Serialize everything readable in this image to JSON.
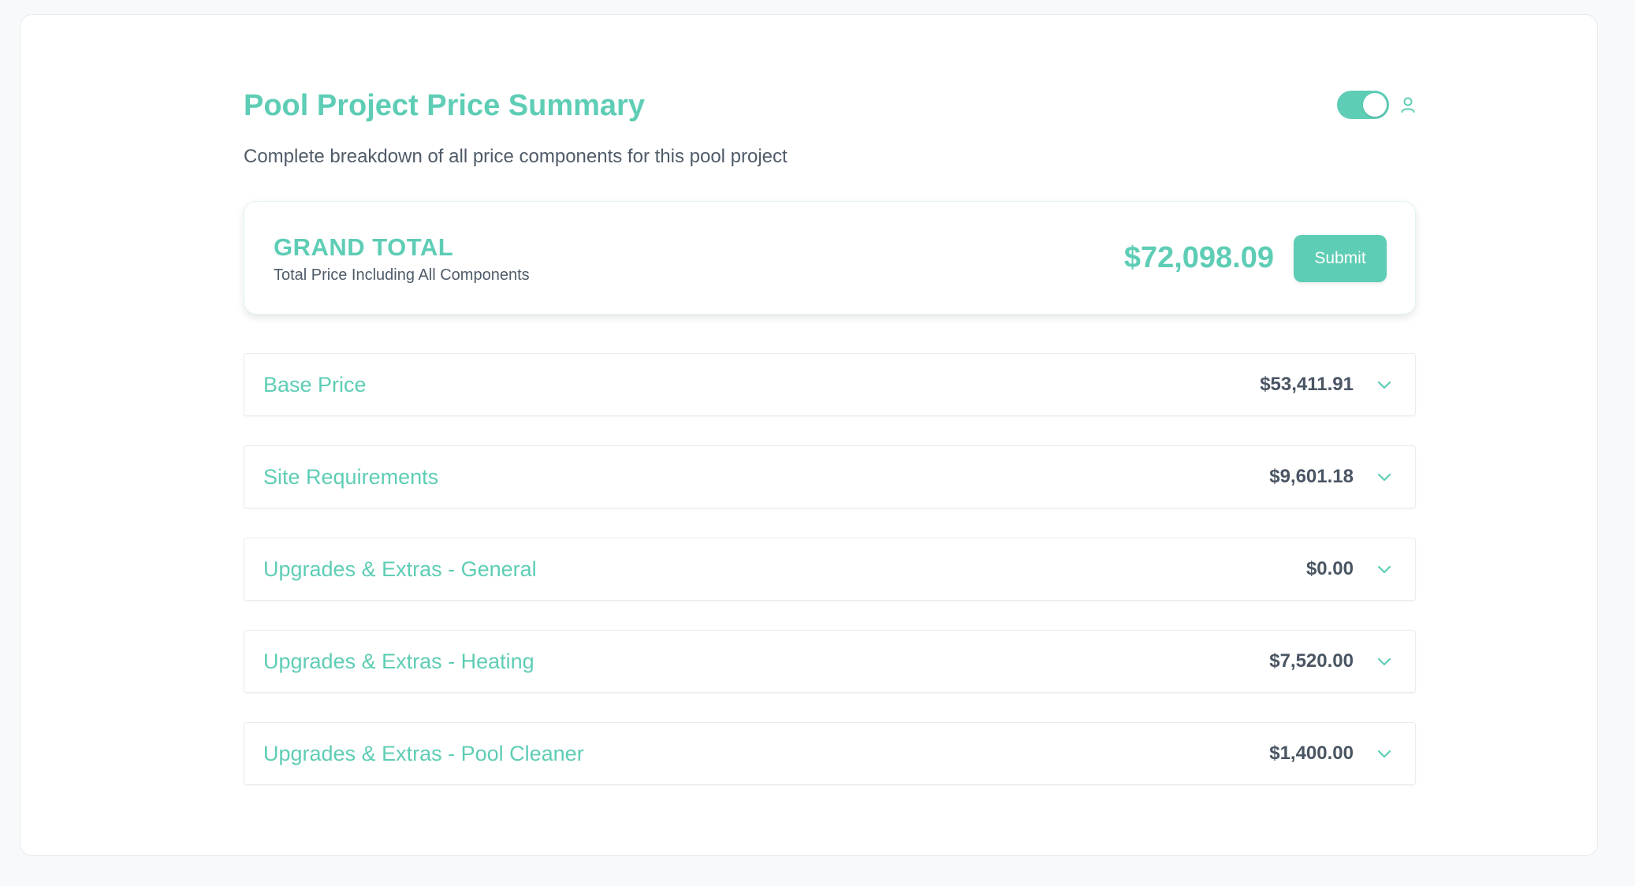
{
  "header": {
    "title": "Pool Project Price Summary",
    "subtitle": "Complete breakdown of all price components for this pool project",
    "toggle_state": "on"
  },
  "grand_total": {
    "label": "GRAND TOTAL",
    "sublabel": "Total Price Including All Components",
    "amount": "$72,098.09",
    "submit_label": "Submit"
  },
  "sections": [
    {
      "name": "Base Price",
      "amount": "$53,411.91"
    },
    {
      "name": "Site Requirements",
      "amount": "$9,601.18"
    },
    {
      "name": "Upgrades & Extras - General",
      "amount": "$0.00"
    },
    {
      "name": "Upgrades & Extras - Heating",
      "amount": "$7,520.00"
    },
    {
      "name": "Upgrades & Extras - Pool Cleaner",
      "amount": "$1,400.00"
    }
  ],
  "icons": {
    "user": "user-icon",
    "chevron": "chevron-down-icon"
  },
  "colors": {
    "accent": "#5ecdb5",
    "text_dark": "#4a5563",
    "text_muted": "#4f5b68",
    "background": "#f7f9fa"
  }
}
